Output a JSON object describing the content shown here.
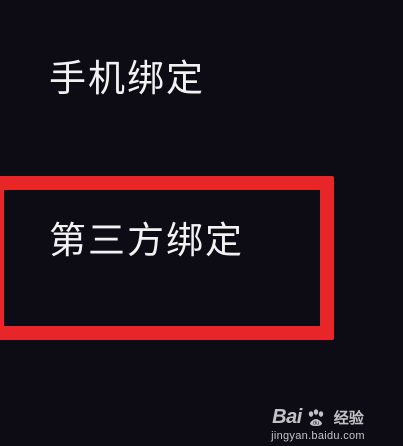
{
  "menu": {
    "items": [
      {
        "label": "手机绑定"
      },
      {
        "label": "第三方绑定"
      }
    ],
    "highlighted_index": 1
  },
  "watermark": {
    "brand_left": "Bai",
    "brand_right": "经验",
    "url": "jingyan.baidu.com"
  },
  "colors": {
    "background": "#0d0c15",
    "text": "#f2f2f2",
    "highlight": "#e8262a"
  },
  "icons": {
    "watermark_logo": "baidu-paw-icon"
  }
}
